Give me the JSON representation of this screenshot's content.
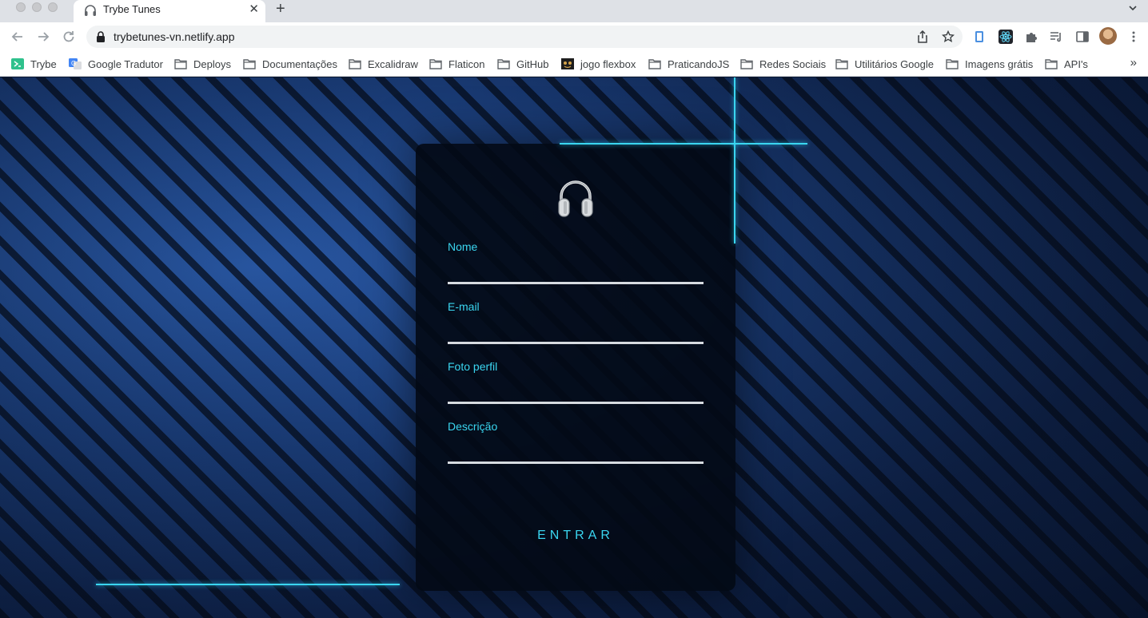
{
  "browser": {
    "tab_title": "Trybe Tunes",
    "tab_close": "✕",
    "new_tab": "+",
    "url": "trybetunes-vn.netlify.app",
    "bookmarks_more": "»",
    "bookmarks": [
      {
        "label": "Trybe",
        "icon": "trybe-icon"
      },
      {
        "label": "Google Tradutor",
        "icon": "google-translate-icon"
      },
      {
        "label": "Deploys",
        "icon": "folder-icon"
      },
      {
        "label": "Documentações",
        "icon": "folder-icon"
      },
      {
        "label": "Excalidraw",
        "icon": "folder-icon"
      },
      {
        "label": "Flaticon",
        "icon": "folder-icon"
      },
      {
        "label": "GitHub",
        "icon": "folder-icon"
      },
      {
        "label": "jogo flexbox",
        "icon": "flexbox-froggy-icon"
      },
      {
        "label": "PraticandoJS",
        "icon": "folder-icon"
      },
      {
        "label": "Redes Sociais",
        "icon": "folder-icon"
      },
      {
        "label": "Utilitários Google",
        "icon": "folder-icon"
      },
      {
        "label": "Imagens grátis",
        "icon": "folder-icon"
      },
      {
        "label": "API's",
        "icon": "folder-icon"
      }
    ]
  },
  "form": {
    "logo_icon": "headphones-icon",
    "fields": [
      {
        "label": "Nome",
        "value": ""
      },
      {
        "label": "E-mail",
        "value": ""
      },
      {
        "label": "Foto perfil",
        "value": ""
      },
      {
        "label": "Descrição",
        "value": ""
      }
    ],
    "submit_label": "ENTRAR"
  },
  "colors": {
    "accent": "#3ad6f0",
    "card_bg": "#030a16",
    "page_bg": "#1a3c77"
  }
}
